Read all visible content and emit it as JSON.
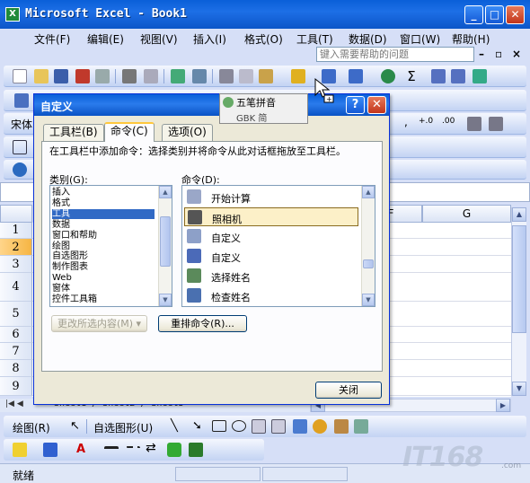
{
  "window": {
    "title": "Microsoft Excel - Book1",
    "app_icon": "X"
  },
  "menu": {
    "items": [
      "文件(F)",
      "编辑(E)",
      "视图(V)",
      "插入(I)",
      "格式(O)",
      "工具(T)",
      "数据(D)",
      "窗口(W)",
      "帮助(H)"
    ],
    "help_placeholder": "键入需要帮助的问题"
  },
  "formatting": {
    "font": "宋体"
  },
  "sheet": {
    "columns": [
      "F",
      "G"
    ],
    "rows": [
      "1",
      "2",
      "3",
      "4",
      "5",
      "6",
      "7",
      "8",
      "9"
    ],
    "tabs_text": "Sheet1 / Sheet2 / Sheet3"
  },
  "drawing_toolbar": {
    "draw_label": "绘图(R)",
    "autoshapes_label": "自选图形(U)"
  },
  "status": {
    "text": "就绪"
  },
  "watermark": {
    "brand": "IT168",
    "domain": ".com"
  },
  "ime": {
    "line1": "五笔拼音",
    "line2": "GBK 简"
  },
  "dialog": {
    "title": "自定义",
    "tabs": [
      "工具栏(B)",
      "命令(C)",
      "选项(O)"
    ],
    "description": "在工具栏中添加命令：选择类别并将命令从此对话框拖放至工具栏。",
    "categories_label": "类别(G):",
    "commands_label": "命令(D):",
    "categories": [
      "插入",
      "格式",
      "工具",
      "数据",
      "窗口和帮助",
      "绘图",
      "自选图形",
      "制作图表",
      "Web",
      "窗体",
      "控件工具箱"
    ],
    "selected_category_index": 2,
    "commands": [
      {
        "label": "开始计算",
        "icon": "calculate-icon"
      },
      {
        "label": "照相机",
        "icon": "camera-icon",
        "selected": true
      },
      {
        "label": "自定义",
        "icon": "customize-icon"
      },
      {
        "label": "自定义",
        "icon": "customize2-icon"
      },
      {
        "label": "选择姓名",
        "icon": "select-name-icon"
      },
      {
        "label": "检查姓名",
        "icon": "check-name-icon"
      }
    ],
    "modify_selection_button": "更改所选内容(M) ▾",
    "rearrange_button": "重排命令(R)...",
    "close_button": "关闭",
    "help_button": "?",
    "close_x": "✕"
  }
}
